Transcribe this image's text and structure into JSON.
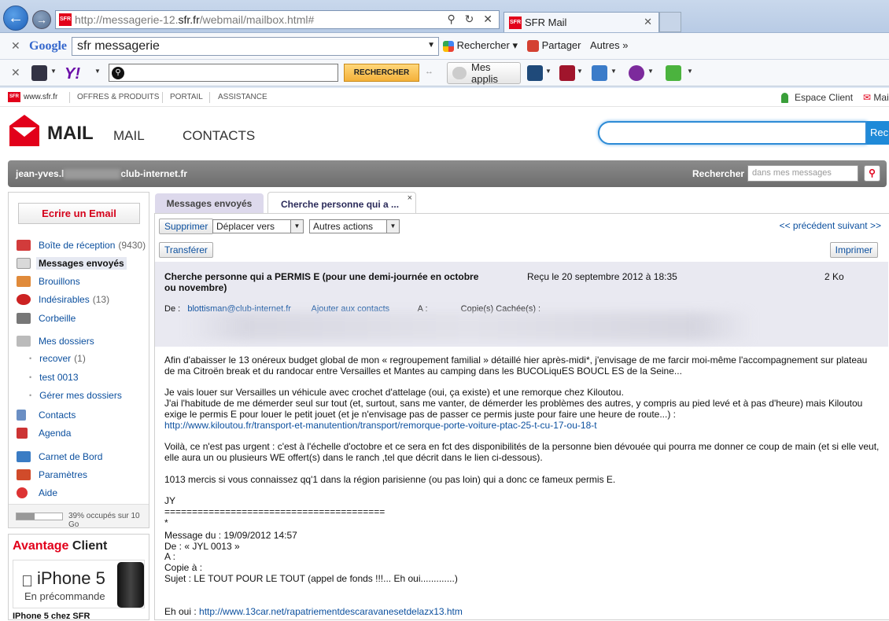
{
  "browser": {
    "url_prefix": "http://messagerie-12.",
    "url_domain": "sfr.fr",
    "url_suffix": "/webmail/mailbox.html#",
    "favicon": "SFR",
    "tab_title": "SFR Mail",
    "google_query": "sfr messagerie",
    "rechercher": "Rechercher",
    "partager": "Partager",
    "autres": "Autres",
    "google_logo": "Google",
    "yahoo_logo": "Y!",
    "recherche_btn": "RECHERCHER",
    "mes_applis": "Mes applis"
  },
  "sfr_topbar": {
    "home": "www.sfr.fr",
    "links": [
      "OFFRES & PRODUITS",
      "PORTAIL",
      "ASSISTANCE"
    ],
    "espace_client": "Espace Client",
    "mail": "Mai"
  },
  "header": {
    "logo_text": "MAIL",
    "nav_mail": "MAIL",
    "nav_contacts": "CONTACTS",
    "search_btn": "Rec"
  },
  "userbar": {
    "email_start": "jean-yves.l",
    "email_end": "club-internet.fr",
    "search_label": "Rechercher",
    "search_placeholder": "dans mes messages"
  },
  "sidebar": {
    "compose": "Ecrire un Email",
    "folders": [
      {
        "label": "Boîte de réception",
        "count": "(9430)"
      },
      {
        "label": "Messages envoyés",
        "count": ""
      },
      {
        "label": "Brouillons",
        "count": ""
      },
      {
        "label": "Indésirables",
        "count": "(13)"
      },
      {
        "label": "Corbeille",
        "count": ""
      },
      {
        "label": "Mes dossiers",
        "count": ""
      },
      {
        "label": "recover",
        "count": "(1)"
      },
      {
        "label": "test 0013",
        "count": ""
      },
      {
        "label": "Gérer mes dossiers",
        "count": ""
      },
      {
        "label": "Contacts",
        "count": ""
      },
      {
        "label": "Agenda",
        "count": ""
      },
      {
        "label": "Carnet de Bord",
        "count": ""
      },
      {
        "label": "Paramètres",
        "count": ""
      },
      {
        "label": "Aide",
        "count": ""
      }
    ],
    "quota_text": "39% occupés sur 10 Go",
    "quota_fraction": 0.39
  },
  "avantage": {
    "title_a": "Avantage",
    "title_b": " Client",
    "iphone_name": "iPhone 5",
    "iphone_sub": "En précommande",
    "footer": "IPhone 5 chez SFR"
  },
  "tabs": {
    "sent": "Messages envoyés",
    "current": "Cherche personne qui a ...",
    "close": "×"
  },
  "actions": {
    "supprimer": "Supprimer",
    "deplacer": "Déplacer vers",
    "autres": "Autres actions",
    "transferer": "Transférer",
    "imprimer": "Imprimer",
    "prec_suiv": "<< précédent suivant >>"
  },
  "message": {
    "subject": "Cherche personne qui a PERMIS E (pour une demi-journée en octobre ou novembre)",
    "received": "Reçu le 20 septembre 2012 à 18:35",
    "size": "2 Ko",
    "de_label": "De :",
    "de_value": "blottisman@club-internet.fr",
    "ajouter": "Ajouter aux contacts",
    "a_label": "A :",
    "cc_label": "Copie(s) Cachée(s) :",
    "body": {
      "p1": "Afin d'abaisser le 13 onéreux budget global de mon « regroupement familial » détaillé hier après-midi*,  j'envisage de me farcir moi-même l'accompagnement sur plateau de ma Citroën break et du randocar entre Versailles et Mantes au camping dans les BUCOLiquES BOUCL ES de la Seine...",
      "p2a": "Je vais louer sur Versailles un véhicule avec crochet d'attelage (oui, ça existe) et une remorque chez Kiloutou.",
      "p2b": "J'ai l'habitude de me démerder seul sur tout (et, surtout, sans me vanter, de démerder les problèmes des autres, y compris au pied levé et à pas d'heure) mais Kiloutou exige le permis E pour louer le petit jouet (et je n'envisage pas de passer ce permis juste pour faire une heure de route...) :",
      "link1": "http://www.kiloutou.fr/transport-et-manutention/transport/remorque-porte-voiture-ptac-25-t-cu-17-ou-18-t",
      "p3": "Voilà, ce n'est pas urgent : c'est à l'échelle d'octobre et ce sera en fct des disponibilités de la personne bien dévouée qui pourra me donner ce coup de main (et si elle veut, elle aura un ou plusieurs WE offert(s) dans le ranch ,tel que décrit dans le lien ci-dessous).",
      "p4": "1013 mercis si vous connaissez qq'1 dans la région parisienne (ou pas loin) qui a donc ce fameux permis E.",
      "sig": "JY",
      "rule": "========================================",
      "star": "*",
      "fw1": "Message du : 19/09/2012 14:57",
      "fw2": "De : « JYL 0013 »",
      "fw3": "A :",
      "fw4": "Copie à :",
      "fw5": "Sujet : LE TOUT POUR LE TOUT (appel de fonds  !!!... Eh oui.............)",
      "eh_label": "Eh oui : ",
      "link2": "http://www.13car.net/rapatriementdescaravanesetdelazx13.htm"
    }
  },
  "colors": {
    "sfr_red": "#e2001a",
    "link_blue": "#0b4f9e",
    "header_grey": "#e9e9f1"
  }
}
